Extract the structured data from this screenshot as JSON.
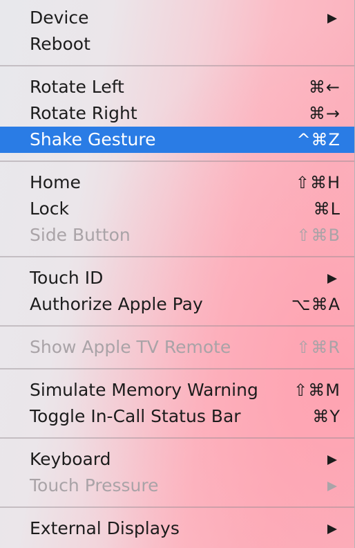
{
  "menu": {
    "groups": [
      {
        "items": [
          {
            "label": "Device",
            "shortcut": "",
            "submenu": true,
            "disabled": false
          },
          {
            "label": "Reboot",
            "shortcut": "",
            "submenu": false,
            "disabled": false
          }
        ]
      },
      {
        "items": [
          {
            "label": "Rotate Left",
            "shortcut": "⌘←",
            "submenu": false,
            "disabled": false
          },
          {
            "label": "Rotate Right",
            "shortcut": "⌘→",
            "submenu": false,
            "disabled": false
          },
          {
            "label": "Shake Gesture",
            "shortcut": "^⌘Z",
            "submenu": false,
            "disabled": false,
            "selected": true
          }
        ]
      },
      {
        "items": [
          {
            "label": "Home",
            "shortcut": "⇧⌘H",
            "submenu": false,
            "disabled": false
          },
          {
            "label": "Lock",
            "shortcut": "⌘L",
            "submenu": false,
            "disabled": false
          },
          {
            "label": "Side Button",
            "shortcut": "⇧⌘B",
            "submenu": false,
            "disabled": true
          }
        ]
      },
      {
        "items": [
          {
            "label": "Touch ID",
            "shortcut": "",
            "submenu": true,
            "disabled": false
          },
          {
            "label": "Authorize Apple Pay",
            "shortcut": "⌥⌘A",
            "submenu": false,
            "disabled": false
          }
        ]
      },
      {
        "items": [
          {
            "label": "Show Apple TV Remote",
            "shortcut": "⇧⌘R",
            "submenu": false,
            "disabled": true
          }
        ]
      },
      {
        "items": [
          {
            "label": "Simulate Memory Warning",
            "shortcut": "⇧⌘M",
            "submenu": false,
            "disabled": false
          },
          {
            "label": "Toggle In-Call Status Bar",
            "shortcut": "⌘Y",
            "submenu": false,
            "disabled": false
          }
        ]
      },
      {
        "items": [
          {
            "label": "Keyboard",
            "shortcut": "",
            "submenu": true,
            "disabled": false
          },
          {
            "label": "Touch Pressure",
            "shortcut": "",
            "submenu": true,
            "disabled": true
          }
        ]
      },
      {
        "items": [
          {
            "label": "External Displays",
            "shortcut": "",
            "submenu": true,
            "disabled": false
          }
        ]
      }
    ],
    "colors": {
      "selection": "#2a7ce5",
      "text": "#1c1c1c",
      "disabled_text": "#a9a3a7"
    }
  }
}
